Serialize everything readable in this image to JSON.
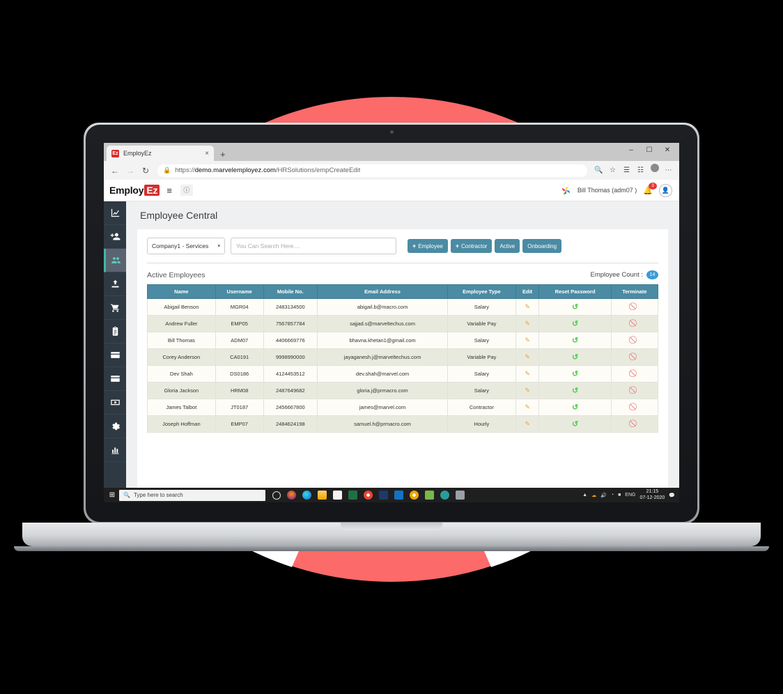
{
  "browser": {
    "tab_title": "EmployEz",
    "favicon_text": "Ez",
    "tab_close": "×",
    "new_tab": "+",
    "back_icon": "←",
    "forward_icon": "→",
    "reload_icon": "↻",
    "lock_icon": "ὑ2",
    "url_scheme": "https://",
    "url_host": "demo.marvelemployez.com",
    "url_path": "/HRSolutions/empCreateEdit",
    "window_minimize": "–",
    "window_maximize": "❐",
    "window_close": "✕",
    "toolbar_icons": [
      "search-icon",
      "star-icon",
      "reading-list-icon",
      "collections-icon",
      "profile-icon",
      "more-icon"
    ]
  },
  "app_header": {
    "logo_main": "Employ",
    "logo_accent": "Ez",
    "menu_icon": "≡",
    "help_icon": "ⓘ",
    "user_name": "Bill Thomas (adm07 )",
    "notification_count": "3",
    "accent_red": "#d32f2f"
  },
  "sidebar": {
    "items": [
      {
        "name": "sidebar-item-dashboard",
        "icon": "line-chart-icon",
        "active": false
      },
      {
        "name": "sidebar-item-add-user",
        "icon": "add-user-icon",
        "active": false
      },
      {
        "name": "sidebar-item-employees",
        "icon": "users-icon",
        "active": true
      },
      {
        "name": "sidebar-item-upload",
        "icon": "upload-icon",
        "active": false
      },
      {
        "name": "sidebar-item-cart",
        "icon": "cart-icon",
        "active": false
      },
      {
        "name": "sidebar-item-clipboard",
        "icon": "clipboard-icon",
        "active": false
      },
      {
        "name": "sidebar-item-card-1",
        "icon": "credit-card-icon",
        "active": false
      },
      {
        "name": "sidebar-item-card-2",
        "icon": "credit-card-icon",
        "active": false
      },
      {
        "name": "sidebar-item-payments",
        "icon": "money-icon",
        "active": false
      },
      {
        "name": "sidebar-item-settings",
        "icon": "gear-icon",
        "active": false
      },
      {
        "name": "sidebar-item-reports",
        "icon": "bar-chart-icon",
        "active": false
      }
    ]
  },
  "page": {
    "title": "Employee Central",
    "company_select": "Company1 - Services",
    "company_caret": "∨",
    "search_placeholder": "You Can Search Here....",
    "buttons": [
      {
        "label": "Employee",
        "plus": "+",
        "name": "add-employee-button"
      },
      {
        "label": "Contractor",
        "plus": "+",
        "name": "add-contractor-button"
      },
      {
        "label": "Active",
        "plus": "",
        "name": "active-filter-button"
      },
      {
        "label": "Onboarding",
        "plus": "",
        "name": "onboarding-filter-button"
      }
    ],
    "section_title": "Active Employees",
    "count_label": "Employee Count :",
    "count_value": "14",
    "accent_teal": "#4b8ba3",
    "count_badge_color": "#3d9bd6"
  },
  "table": {
    "columns": [
      "Name",
      "Username",
      "Mobile No.",
      "Email Address",
      "Employee Type",
      "Edit",
      "Reset Password",
      "Terminate"
    ],
    "edit_icon": "✎",
    "reset_icon": "↺",
    "terminate_icon": "⃠",
    "rows": [
      {
        "name": "Abigail Benson",
        "username": "MGR04",
        "mobile": "2483134500",
        "email": "abigail.b@macro.com",
        "type": "Salary"
      },
      {
        "name": "Andrew Fuller",
        "username": "EMP05",
        "mobile": "7567857784",
        "email": "sajjad.s@marveltechus.com",
        "type": "Variable Pay"
      },
      {
        "name": "Bill Thomas",
        "username": "ADM07",
        "mobile": "4406669776",
        "email": "bhavna.khetan1@gmail.com",
        "type": "Salary"
      },
      {
        "name": "Corey Anderson",
        "username": "CA0191",
        "mobile": "9998990000",
        "email": "jayaganesh.j@marveltechus.com",
        "type": "Variable Pay"
      },
      {
        "name": "Dev Shah",
        "username": "DS0186",
        "mobile": "4124453512",
        "email": "dev.shah@marvel.com",
        "type": "Salary"
      },
      {
        "name": "Gloria Jackson",
        "username": "HRM08",
        "mobile": "2487649682",
        "email": "gloria.j@prmacro.com",
        "type": "Salary"
      },
      {
        "name": "James Talbot",
        "username": "JT0187",
        "mobile": "2456667800",
        "email": "james@marvel.com",
        "type": "Contractor"
      },
      {
        "name": "Joseph Hoffman",
        "username": "EMP07",
        "mobile": "2484624198",
        "email": "samuel.h@prmacro.com",
        "type": "Hourly"
      }
    ]
  },
  "taskbar": {
    "start_icon": "⊞",
    "search_placeholder": "Type here to search",
    "search_icon": "⌕",
    "apps": [
      "cortana-icon",
      "firefox-icon",
      "edge-icon",
      "explorer-icon",
      "store-icon",
      "excel-icon",
      "chrome-icon",
      "app-icon-blue",
      "mail-icon",
      "chrome-2-icon",
      "app-icon-green",
      "app-icon-teal",
      "app-icon-grey"
    ],
    "tray": [
      "chevron-up-icon",
      "onedrive-icon",
      "volume-icon",
      "wifi-icon",
      "battery-icon"
    ],
    "language": "ENG",
    "time": "21:15",
    "date": "07-12-2020",
    "action_center_icon": "☐"
  },
  "decor": {
    "ring_color": "#fc6a6a",
    "ring_white": "#ffffff"
  }
}
